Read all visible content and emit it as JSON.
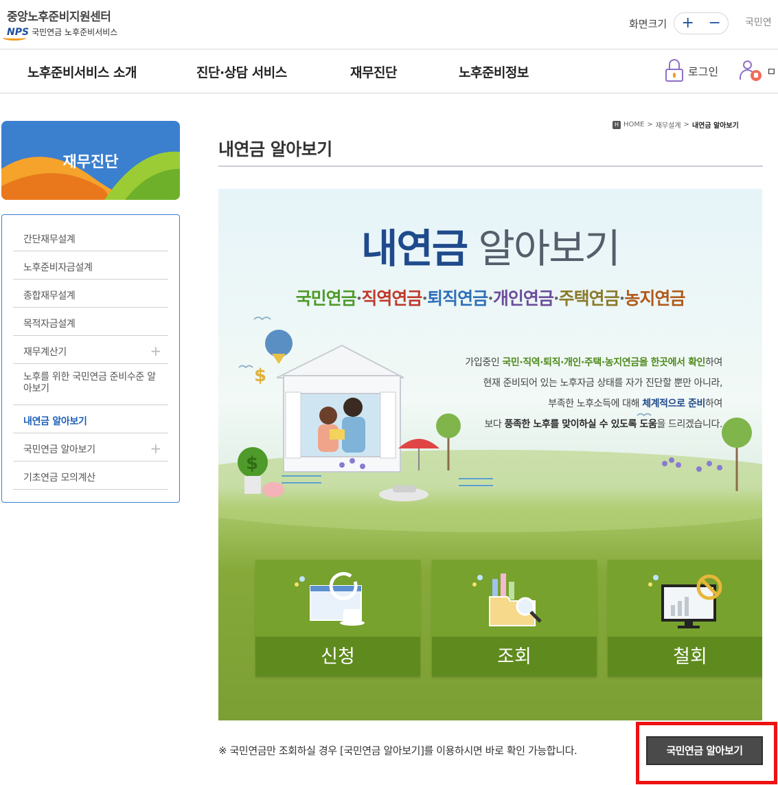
{
  "header": {
    "org_title": "중앙노후준비지원센터",
    "nps_mark": "NPS",
    "org_sub": "국민연금 노후준비서비스",
    "font_size_label": "화면크기",
    "font_plus": "+",
    "font_minus": "−",
    "nps_link": "국민연"
  },
  "nav": {
    "items": [
      {
        "label": "노후준비서비스 소개"
      },
      {
        "label": "진단·상담 서비스"
      },
      {
        "label": "재무진단"
      },
      {
        "label": "노후준비정보"
      }
    ],
    "login": "로그인",
    "mypage_partial": "ㅁ"
  },
  "sidebar": {
    "title": "재무진단",
    "items": [
      {
        "label": "간단재무설계",
        "has_sub": false
      },
      {
        "label": "노후준비자금설계",
        "has_sub": false
      },
      {
        "label": "종합재무설계",
        "has_sub": false
      },
      {
        "label": "목적자금설계",
        "has_sub": false
      },
      {
        "label": "재무계산기",
        "has_sub": true
      },
      {
        "label": "노후를 위한 국민연금 준비수준 알아보기",
        "has_sub": false
      },
      {
        "label": "내연금 알아보기",
        "has_sub": false,
        "active": true
      },
      {
        "label": "국민연금 알아보기",
        "has_sub": true
      },
      {
        "label": "기초연금 모의계산",
        "has_sub": false
      }
    ]
  },
  "breadcrumb": {
    "home": "HOME",
    "sep": ">",
    "parent": "재무설계",
    "current": "내연금 알아보기"
  },
  "page": {
    "title": "내연금 알아보기"
  },
  "banner": {
    "title_strong": "내연금",
    "title_light": "알아보기",
    "pensions": [
      {
        "label": "국민연금",
        "color": "#4e9a2a"
      },
      {
        "label": "직역연금",
        "color": "#c0392b"
      },
      {
        "label": "퇴직연금",
        "color": "#2e6fb7"
      },
      {
        "label": "개인연금",
        "color": "#6b4c9a"
      },
      {
        "label": "주택연금",
        "color": "#8a7a2a"
      },
      {
        "label": "농지연금",
        "color": "#b05a1a"
      }
    ],
    "separator": "·",
    "desc": {
      "line1_pre": "가입중인 ",
      "line1_bold": "국민·직역·퇴직·개인·주택·농지연금을 한곳에서 확인",
      "line1_post": "하여",
      "line2": "현재 준비되어 있는 노후자금 상태를 자가 진단할 뿐만 아니라,",
      "line3_pre": "부족한 노후소득에 대해 ",
      "line3_bold": "체계적으로 준비",
      "line3_post": "하여",
      "line4_pre": "보다 ",
      "line4_bold": "풍족한 노후를 맞이하실 수 있도록 도움",
      "line4_post": "을 드리겠습니다."
    },
    "tiles": [
      {
        "label": "신청",
        "icon": "window-coffee-icon"
      },
      {
        "label": "조회",
        "icon": "folder-magnifier-icon"
      },
      {
        "label": "철회",
        "icon": "monitor-cancel-icon"
      }
    ]
  },
  "footer_note": {
    "text": "※  국민연금만 조회하실 경우 [국민연금 알아보기]를 이용하시면 바로 확인 가능합니다.",
    "button": "국민연금 알아보기"
  }
}
